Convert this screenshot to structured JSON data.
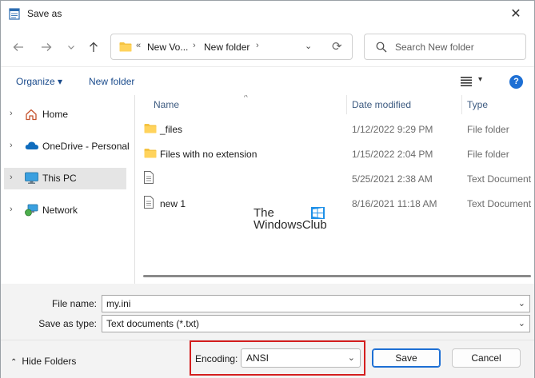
{
  "window": {
    "title": "Save as",
    "close_glyph": "✕"
  },
  "nav": {
    "back_icon": "arrow-left-icon",
    "forward_icon": "arrow-right-icon",
    "recent_icon": "chevron-down-icon",
    "up_icon": "arrow-up-icon",
    "breadcrumb_prefix": "«",
    "breadcrumbs": [
      "New Vo...",
      "New folder"
    ],
    "crumb_separator": "›",
    "address_dropdown": "⌄",
    "refresh_glyph": "⟳",
    "search_placeholder": "Search New folder"
  },
  "toolbar": {
    "organize_label": "Organize ▾",
    "new_folder_label": "New folder",
    "view_dropdown": "▾",
    "help_label": "?"
  },
  "sidebar": {
    "items": [
      {
        "label": "Home",
        "icon": "home-icon"
      },
      {
        "label": "OneDrive - Personal",
        "icon": "cloud-icon"
      },
      {
        "label": "This PC",
        "icon": "monitor-icon",
        "selected": true
      },
      {
        "label": "Network",
        "icon": "network-icon"
      }
    ],
    "chevron": "›"
  },
  "filelist": {
    "columns": {
      "name": "Name",
      "date": "Date modified",
      "type": "Type"
    },
    "sort_indicator": "^",
    "rows": [
      {
        "name": "_files",
        "date": "1/12/2022 9:29 PM",
        "type": "File folder",
        "icon": "folder-icon"
      },
      {
        "name": "Files with no extension",
        "date": "1/15/2022 2:04 PM",
        "type": "File folder",
        "icon": "folder-icon"
      },
      {
        "name": "",
        "date": "5/25/2021 2:38 AM",
        "type": "Text Document",
        "icon": "text-file-icon"
      },
      {
        "name": "new 1",
        "date": "8/16/2021 11:18 AM",
        "type": "Text Document",
        "icon": "text-file-icon"
      }
    ]
  },
  "watermark": {
    "line1": "The",
    "line2": "WindowsClub"
  },
  "form": {
    "file_name_label": "File name:",
    "file_name_value": "my.ini",
    "save_as_type_label": "Save as type:",
    "save_as_type_value": "Text documents (*.txt)",
    "dropdown_glyph": "⌄"
  },
  "actions": {
    "hide_folders_caret": "⌃",
    "hide_folders_label": "Hide Folders",
    "encoding_label": "Encoding:",
    "encoding_value": "ANSI",
    "save_label": "Save",
    "cancel_label": "Cancel"
  },
  "colors": {
    "accent": "#1d6fd4",
    "highlight": "#d41e1e",
    "folder": "#f5c342"
  }
}
